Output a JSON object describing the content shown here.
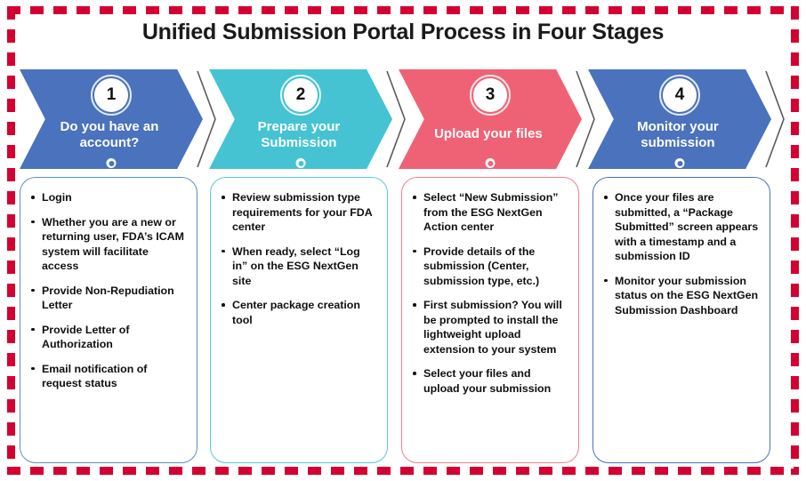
{
  "page": {
    "title": "Unified Submission Portal Process in Four Stages",
    "border_color": "#d50032",
    "background": "#ffffff"
  },
  "stages": [
    {
      "number": "1",
      "label": "Do you have an account?",
      "color": "#4a72bd",
      "card_border": "#5b8fc9",
      "items": [
        "Login",
        "Whether you are a new or returning user, FDA’s ICAM system will facilitate access",
        "Provide Non-Repudiation Letter",
        "Provide Letter of Authorization",
        "Email notification of request status"
      ]
    },
    {
      "number": "2",
      "label": "Prepare your Submission",
      "color": "#45c3d2",
      "card_border": "#55c9da",
      "items": [
        "Review submission type requirements for your FDA center",
        "When ready, select “Log in” on the ESG NextGen site",
        "Center package creation tool"
      ]
    },
    {
      "number": "3",
      "label": "Upload your files",
      "color": "#ef6275",
      "card_border": "#f4808f",
      "items": [
        "Select “New Submission” from the ESG NextGen Action center",
        "Provide details of the submission (Center, submission type, etc.)",
        "First submission? You will be prompted to install the lightweight upload extension to your system",
        "Select your files and upload your submission"
      ]
    },
    {
      "number": "4",
      "label": "Monitor your submission",
      "color": "#4a72bd",
      "card_border": "#4f6fc0",
      "items": [
        "Once your files are submitted, a “Package Submitted” screen appears with a timestamp and a submission ID",
        "Monitor your submission status on the ESG NextGen Submission Dashboard"
      ]
    }
  ]
}
